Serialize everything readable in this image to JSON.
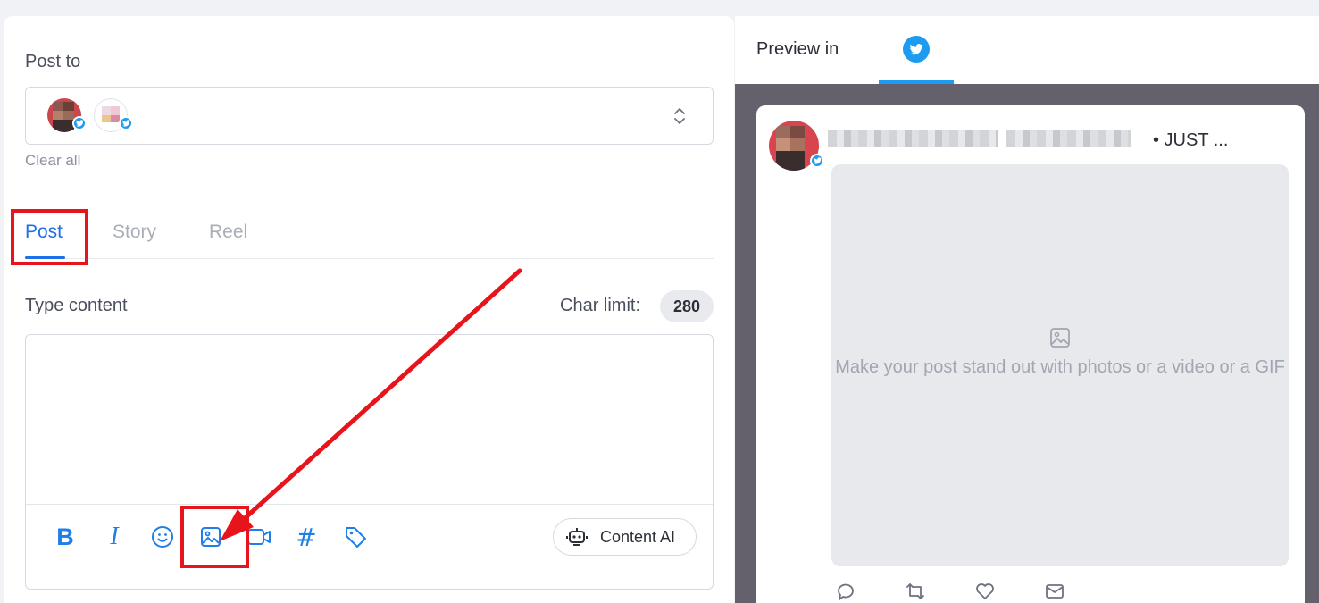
{
  "composer": {
    "post_to_label": "Post to",
    "clear_all": "Clear all",
    "tabs": [
      {
        "label": "Post",
        "active": true
      },
      {
        "label": "Story",
        "active": false
      },
      {
        "label": "Reel",
        "active": false
      }
    ],
    "type_content_label": "Type content",
    "char_limit_label": "Char limit:",
    "char_limit_value": "280",
    "toolbar": {
      "bold_label": "B",
      "italic_label": "I",
      "hashtag_label": "#",
      "content_ai_label": "Content AI"
    }
  },
  "preview": {
    "title": "Preview in",
    "tab_icon": "twitter-icon",
    "timestamp": "• JUST ...",
    "media_placeholder": "Make your post stand out with photos or a video or a GIF",
    "actions": [
      "reply-icon",
      "retweet-icon",
      "like-icon",
      "share-mail-icon"
    ]
  },
  "colors": {
    "accent": "#1f6fe5",
    "twitter": "#1d9bf0",
    "annotation_red": "#e8141c",
    "preview_bg": "#64616c"
  }
}
